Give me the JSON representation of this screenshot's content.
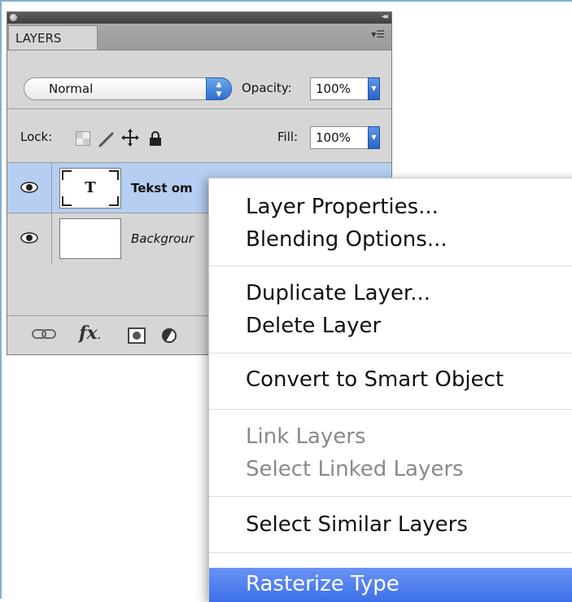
{
  "panel": {
    "tab_label": "LAYERS",
    "blend_mode": "Normal",
    "opacity_label": "Opacity:",
    "opacity_value": "100%",
    "lock_label": "Lock:",
    "fill_label": "Fill:",
    "fill_value": "100%",
    "layers": [
      {
        "name": "Tekst om",
        "thumb_text": "T",
        "selected": true
      },
      {
        "name": "Backgrour",
        "thumb_text": "",
        "selected": false
      }
    ]
  },
  "context_menu": {
    "items": [
      {
        "label": "Layer Properties...",
        "enabled": true
      },
      {
        "label": "Blending Options...",
        "enabled": true
      },
      {
        "label": "Duplicate Layer...",
        "enabled": true
      },
      {
        "label": "Delete Layer",
        "enabled": true
      },
      {
        "label": "Convert to Smart Object",
        "enabled": true
      },
      {
        "label": "Link Layers",
        "enabled": false
      },
      {
        "label": "Select Linked Layers",
        "enabled": false
      },
      {
        "label": "Select Similar Layers",
        "enabled": true
      },
      {
        "label": "Rasterize Type",
        "enabled": true,
        "highlighted": true
      }
    ]
  },
  "icons": {
    "eye": "eye-icon",
    "link": "link-icon",
    "fx": "fx-icon",
    "mask": "layer-mask-icon",
    "adjustment": "adjustment-layer-icon",
    "lock_transparent": "lock-transparent-pixels-icon",
    "lock_paint": "lock-image-pixels-icon",
    "lock_move": "lock-position-icon",
    "lock_all": "lock-all-icon"
  },
  "colors": {
    "selection": "#b5cef2",
    "menu_highlight": "#3c6fe8",
    "disabled_text": "#8a8a8a"
  }
}
